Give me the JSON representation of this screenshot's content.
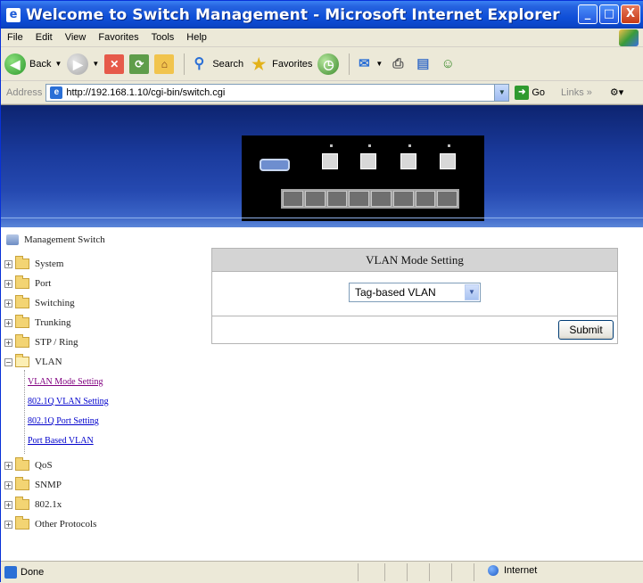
{
  "window": {
    "title": "Welcome to Switch Management - Microsoft Internet Explorer",
    "controls": [
      "_",
      "□",
      "X"
    ]
  },
  "menu": [
    "File",
    "Edit",
    "View",
    "Favorites",
    "Tools",
    "Help"
  ],
  "toolbar": {
    "back": "Back",
    "search": "Search",
    "favorites": "Favorites"
  },
  "address": {
    "label": "Address",
    "url": "http://192.168.1.10/cgi-bin/switch.cgi",
    "go": "Go",
    "links": "Links »"
  },
  "tree": {
    "root": "Management Switch",
    "items": [
      {
        "label": "System",
        "expanded": false
      },
      {
        "label": "Port",
        "expanded": false
      },
      {
        "label": "Switching",
        "expanded": false
      },
      {
        "label": "Trunking",
        "expanded": false
      },
      {
        "label": "STP / Ring",
        "expanded": false
      },
      {
        "label": "VLAN",
        "expanded": true
      },
      {
        "label": "QoS",
        "expanded": false
      },
      {
        "label": "SNMP",
        "expanded": false
      },
      {
        "label": "802.1x",
        "expanded": false
      },
      {
        "label": "Other Protocols",
        "expanded": false
      }
    ],
    "vlan_children": [
      {
        "label": "VLAN Mode Setting",
        "visited": true
      },
      {
        "label": "802.1Q VLAN Setting",
        "visited": false
      },
      {
        "label": "802.1Q Port Setting",
        "visited": false
      },
      {
        "label": "Port Based VLAN",
        "visited": false
      }
    ]
  },
  "panel": {
    "title": "VLAN Mode Setting",
    "mode_selected": "Tag-based VLAN",
    "submit": "Submit"
  },
  "status": {
    "text": "Done",
    "zone": "Internet"
  },
  "colors": {
    "titlebar": "#0F4FD8",
    "banner": "#1a3a9c",
    "link": "#0000CC",
    "visited_link": "#800080"
  }
}
